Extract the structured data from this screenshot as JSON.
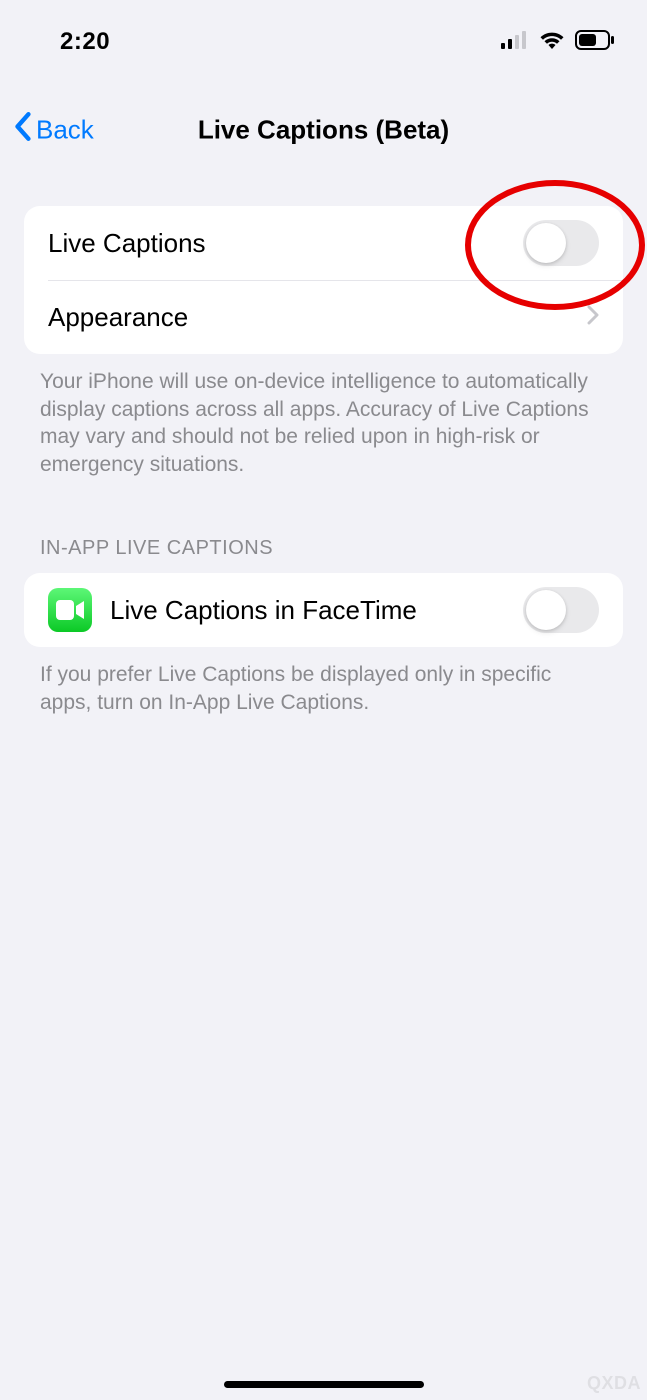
{
  "status": {
    "time": "2:20"
  },
  "nav": {
    "back": "Back",
    "title": "Live Captions (Beta)"
  },
  "group1": {
    "live_captions_label": "Live Captions",
    "appearance_label": "Appearance",
    "footer": "Your iPhone will use on-device intelligence to automatically display captions across all apps. Accuracy of Live Captions may vary and should not be relied upon in high-risk or emergency situations."
  },
  "group2": {
    "header": "In-App Live Captions",
    "facetime_label": "Live Captions in FaceTime",
    "footer": "If you prefer Live Captions be displayed only in specific apps, turn on In-App Live Captions."
  },
  "toggles": {
    "live_captions": false,
    "facetime": false
  },
  "icons": {
    "facetime": "facetime-icon"
  },
  "watermark": "QXDA"
}
